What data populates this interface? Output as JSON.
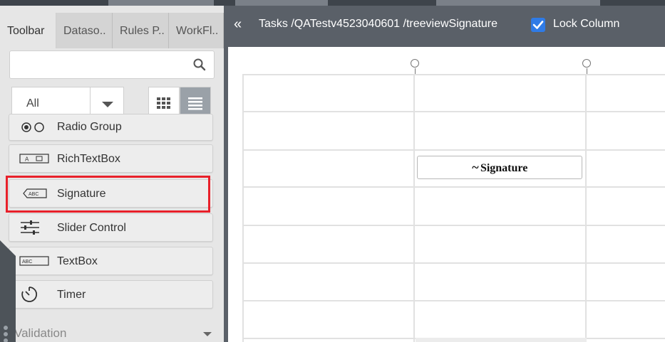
{
  "tabs": [
    {
      "label": "Toolbar",
      "active": true
    },
    {
      "label": "Dataso..",
      "active": false
    },
    {
      "label": "Rules P..",
      "active": false
    },
    {
      "label": "WorkFl..",
      "active": false
    }
  ],
  "search": {
    "value": "",
    "placeholder": "",
    "icon": "search-icon"
  },
  "filter": {
    "selected": "All"
  },
  "view_modes": {
    "grid_icon": "grid-view-icon",
    "list_icon": "list-view-icon",
    "active": "list"
  },
  "toolbox_items": [
    {
      "label": "Radio Group",
      "icon": "radio-group-icon"
    },
    {
      "label": "RichTextBox",
      "icon": "richtextbox-icon"
    },
    {
      "label": "Signature",
      "icon": "signature-icon",
      "highlighted": true
    },
    {
      "label": "Slider Control",
      "icon": "slider-control-icon"
    },
    {
      "label": "TextBox",
      "icon": "textbox-icon"
    },
    {
      "label": "Timer",
      "icon": "timer-icon"
    }
  ],
  "sections": [
    {
      "label": "Validation",
      "collapsed": true
    }
  ],
  "header": {
    "collapse_icon": "double-chevron-left-icon",
    "path": "Tasks /QATestv4523040601 /treeviewSignature",
    "lock_column": {
      "label": "Lock Column",
      "checked": true
    }
  },
  "canvas": {
    "signature_control": {
      "text": "Signature",
      "mark": "~"
    }
  },
  "colors": {
    "accent_checkbox": "#2f7be6",
    "highlight": "#e8202a",
    "header_bg": "#5a6068"
  }
}
